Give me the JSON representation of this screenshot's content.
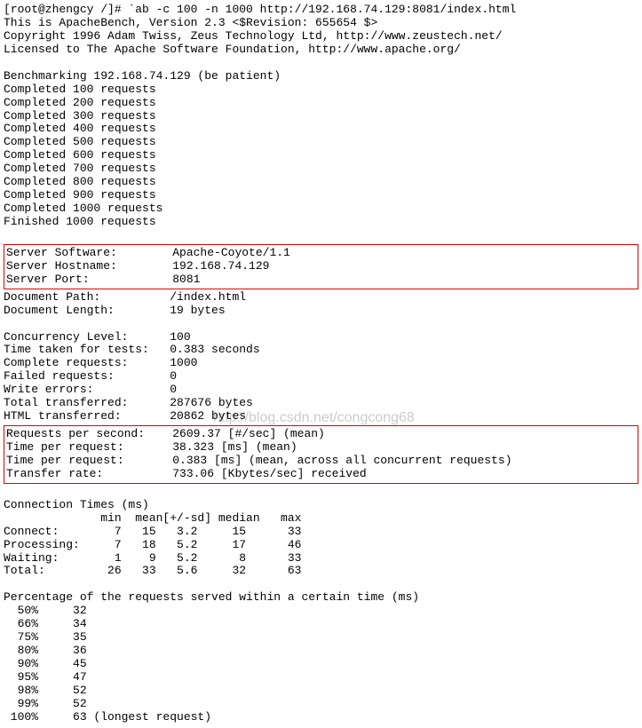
{
  "watermark": "http://blog.csdn.net/congcong68",
  "cmd": "[root@zhengcy /]# `ab -c 100 -n 1000 http://192.168.74.129:8081/index.html",
  "intro1": "This is ApacheBench, Version 2.3 <$Revision: 655654 $>",
  "intro2": "Copyright 1996 Adam Twiss, Zeus Technology Ltd, http://www.zeustech.net/",
  "intro3": "Licensed to The Apache Software Foundation, http://www.apache.org/",
  "bench": "Benchmarking 192.168.74.129 (be patient)",
  "c1": "Completed 100 requests",
  "c2": "Completed 200 requests",
  "c3": "Completed 300 requests",
  "c4": "Completed 400 requests",
  "c5": "Completed 500 requests",
  "c6": "Completed 600 requests",
  "c7": "Completed 700 requests",
  "c8": "Completed 800 requests",
  "c9": "Completed 900 requests",
  "c10": "Completed 1000 requests",
  "fin": "Finished 1000 requests",
  "ss": "Server Software:        Apache-Coyote/1.1",
  "sh": "Server Hostname:        192.168.74.129",
  "sp": "Server Port:            8081",
  "dp": "Document Path:          /index.html",
  "dl": "Document Length:        19 bytes",
  "cl": "Concurrency Level:      100",
  "tt": "Time taken for tests:   0.383 seconds",
  "cr": "Complete requests:      1000",
  "fr": "Failed requests:        0",
  "we": "Write errors:           0",
  "tx": "Total transferred:      287676 bytes",
  "ht": "HTML transferred:       20862 bytes",
  "rps": "Requests per second:    2609.37 [#/sec] (mean)",
  "tpr1": "Time per request:       38.323 [ms] (mean)",
  "tpr2": "Time per request:       0.383 [ms] (mean, across all concurrent requests)",
  "tr": "Transfer rate:          733.06 [Kbytes/sec] received",
  "ct_hdr": "Connection Times (ms)",
  "ct_cols": "              min  mean[+/-sd] median   max",
  "ct_conn": "Connect:        7   15   3.2     15      33",
  "ct_proc": "Processing:     7   18   5.2     17      46",
  "ct_wait": "Waiting:        1    9   5.2      8      33",
  "ct_tot": "Total:         26   33   5.6     32      63",
  "pct_hdr": "Percentage of the requests served within a certain time (ms)",
  "p50": "  50%     32",
  "p66": "  66%     34",
  "p75": "  75%     35",
  "p80": "  80%     36",
  "p90": "  90%     45",
  "p95": "  95%     47",
  "p98": "  98%     52",
  "p99": "  99%     52",
  "p100": " 100%     63 (longest request)"
}
